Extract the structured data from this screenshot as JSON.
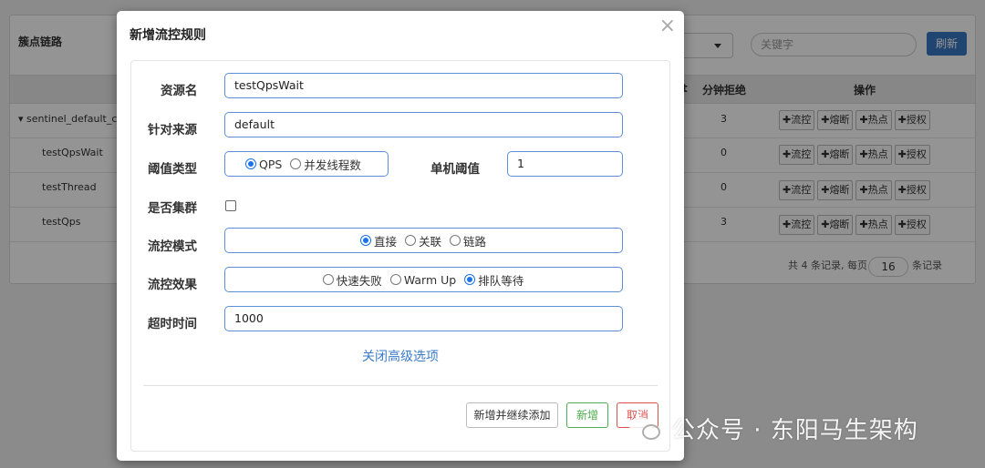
{
  "background": {
    "header_title": "簇点链路",
    "search_placeholder": "关键字",
    "refresh_label": "刷新",
    "columns": {
      "rejected": "分钟拒绝",
      "actions": "操作",
      "partial": "t"
    },
    "rows": [
      {
        "name": "▾ sentinel_default_co",
        "rejected": "3"
      },
      {
        "name": "testQpsWait",
        "rejected": "0"
      },
      {
        "name": "testThread",
        "rejected": "0"
      },
      {
        "name": "testQps",
        "rejected": "3"
      }
    ],
    "row_actions": [
      "流控",
      "熔断",
      "热点",
      "授权"
    ],
    "pagination": {
      "prefix": "共 4 条记录, 每页",
      "page_size": "16",
      "suffix": "条记录"
    }
  },
  "modal": {
    "title": "新增流控规则",
    "close_icon": "×",
    "fields": {
      "resource_name": {
        "label": "资源名",
        "value": "testQpsWait"
      },
      "limit_app": {
        "label": "针对来源",
        "value": "default"
      },
      "threshold_type": {
        "label": "阈值类型",
        "options": [
          "QPS",
          "并发线程数"
        ],
        "selected": "QPS"
      },
      "threshold": {
        "label": "单机阈值",
        "value": "1"
      },
      "cluster": {
        "label": "是否集群",
        "checked": false
      },
      "strategy": {
        "label": "流控模式",
        "options": [
          "直接",
          "关联",
          "链路"
        ],
        "selected": "直接"
      },
      "control_behavior": {
        "label": "流控效果",
        "options": [
          "快速失败",
          "Warm Up",
          "排队等待"
        ],
        "selected": "排队等待"
      },
      "timeout": {
        "label": "超时时间",
        "value": "1000"
      }
    },
    "advanced_link": "关闭高级选项",
    "buttons": {
      "continue": "新增并继续添加",
      "add": "新增",
      "cancel": "取消"
    }
  },
  "watermark": {
    "text": "公众号 · 东阳马生架构"
  }
}
